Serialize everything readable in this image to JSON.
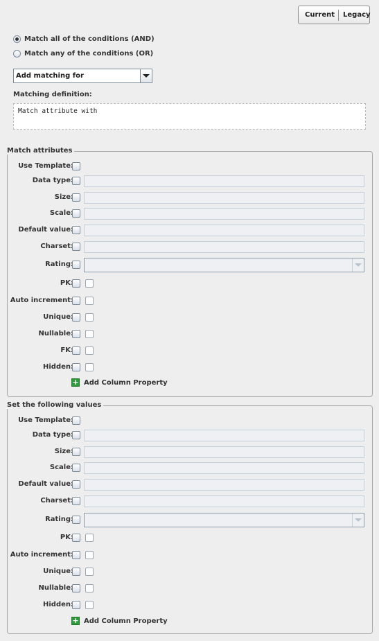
{
  "mode_toggle": {
    "current_label": "Current",
    "legacy_label": "Legacy"
  },
  "match_mode": {
    "and_label": "Match all of the conditions (AND)",
    "or_label": "Match any of the conditions (OR)",
    "selected": "and"
  },
  "matching_combo": {
    "value": "Add matching for"
  },
  "matching_definition": {
    "label": "Matching definition:",
    "text": "Match attribute with"
  },
  "match_attributes": {
    "title": "Match attributes",
    "labels": {
      "use_template": "Use Template:",
      "data_type": "Data type:",
      "size": "Size:",
      "scale": "Scale:",
      "default_value": "Default value:",
      "charset": "Charset:",
      "rating": "Rating:",
      "pk": "PK:",
      "auto_increment": "Auto increment:",
      "unique": "Unique:",
      "nullable": "Nullable:",
      "fk": "FK:",
      "hidden": "Hidden:"
    },
    "add_property_label": "Add Column Property"
  },
  "set_values": {
    "title": "Set the following values",
    "labels": {
      "use_template": "Use Template:",
      "data_type": "Data type:",
      "size": "Size:",
      "scale": "Scale:",
      "default_value": "Default value:",
      "charset": "Charset:",
      "rating": "Rating:",
      "pk": "PK:",
      "auto_increment": "Auto increment:",
      "unique": "Unique:",
      "nullable": "Nullable:",
      "hidden": "Hidden:"
    },
    "add_property_label": "Add Column Property"
  },
  "colors": {
    "background": "#eeeeee",
    "add_icon": "#2f9a3a"
  }
}
